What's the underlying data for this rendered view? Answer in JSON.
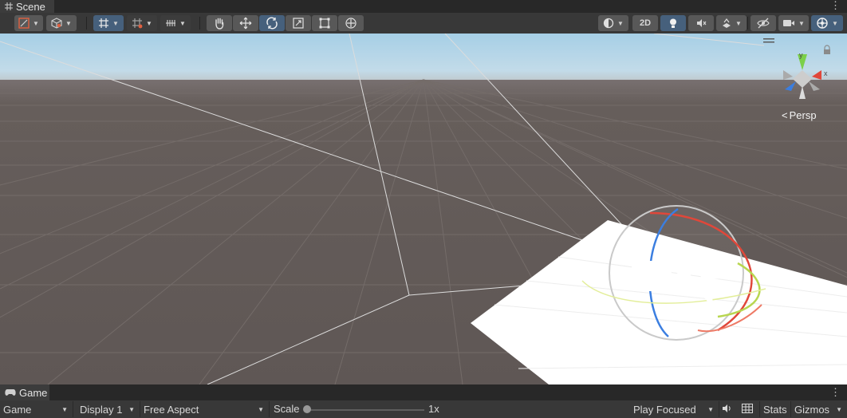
{
  "scene_tab": {
    "title": "Scene",
    "menu": "⋮"
  },
  "scene_toolbar": {
    "mode_2d": "2D"
  },
  "gizmo": {
    "y_axis": "y",
    "x_axis": "x",
    "persp_label": "Persp"
  },
  "game_tab": {
    "title": "Game",
    "menu": "⋮"
  },
  "game_toolbar": {
    "view": "Game",
    "display": "Display 1",
    "aspect": "Free Aspect",
    "scale_label": "Scale",
    "scale_value": "1x",
    "play_mode": "Play Focused",
    "stats": "Stats",
    "gizmos": "Gizmos"
  },
  "colors": {
    "sky_top": "#a6cfe6",
    "ground": "#615956",
    "selected_button": "#46607c",
    "gizmo_x": "#e0473a",
    "gizmo_y": "#7bd04a",
    "gizmo_z": "#3b7ee0"
  },
  "icons": [
    "scene-grid-icon",
    "shading-mode-icon",
    "cube-icon",
    "grid-snap-icon",
    "hand-tool-icon",
    "move-tool-icon",
    "rotate-tool-icon",
    "scale-tool-icon",
    "rect-tool-icon",
    "transform-tool-icon",
    "lighting-icon",
    "audio-mute-icon",
    "effects-icon",
    "visibility-icon",
    "camera-icon",
    "gizmos-icon",
    "lock-icon",
    "gamepad-icon",
    "speaker-icon",
    "grid-layout-icon"
  ]
}
